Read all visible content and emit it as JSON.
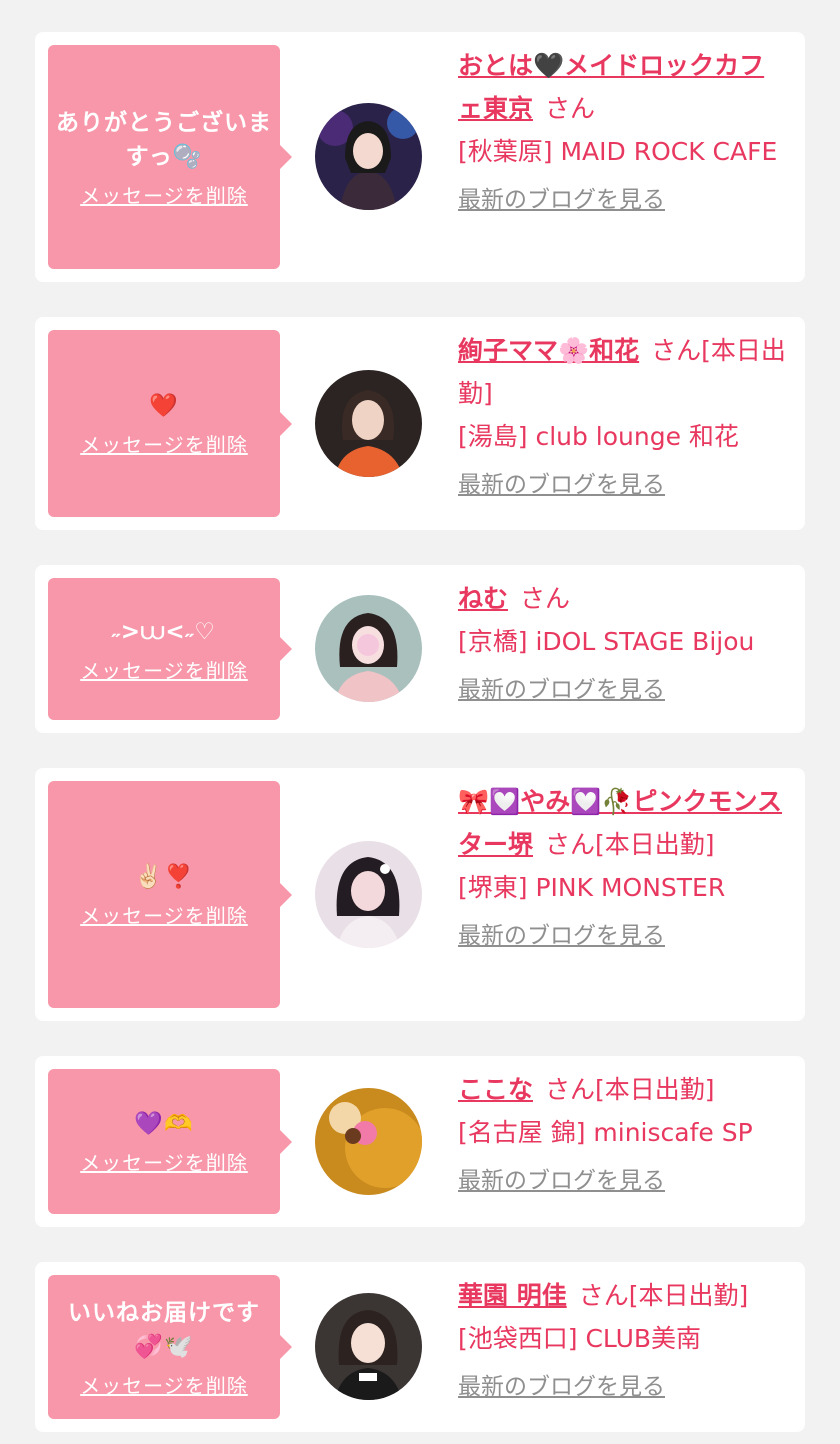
{
  "delete_label": "メッセージを削除",
  "blog_label": "最新のブログを見る",
  "cards": [
    {
      "message": "ありがとうございますっ🫧",
      "name": "おとは🖤メイドロックカフェ東京",
      "suffix": "さん",
      "shop": "[秋葉原] MAID ROCK CAFE"
    },
    {
      "message": "❤️",
      "name": "絢子ママ🌸和花",
      "suffix": "さん[本日出勤]",
      "shop": "[湯島] club lounge 和花"
    },
    {
      "message": "˶>⩊<˶♡",
      "name": "ねむ",
      "suffix": "さん",
      "shop": "[京橋] iDOL STAGE Bijou"
    },
    {
      "message": "✌🏻❣️",
      "name": "🎀💟やみ💟🥀ピンクモンスター堺",
      "suffix": "さん[本日出勤]",
      "shop": "[堺東] PINK MONSTER"
    },
    {
      "message": "💜🫶",
      "name": "ここな",
      "suffix": "さん[本日出勤]",
      "shop": "[名古屋 錦] miniscafe SP"
    },
    {
      "message": "いいねお届けです💞🕊️",
      "name": "華園 明佳",
      "suffix": "さん[本日出勤]",
      "shop": "[池袋西口] CLUB美南"
    }
  ]
}
